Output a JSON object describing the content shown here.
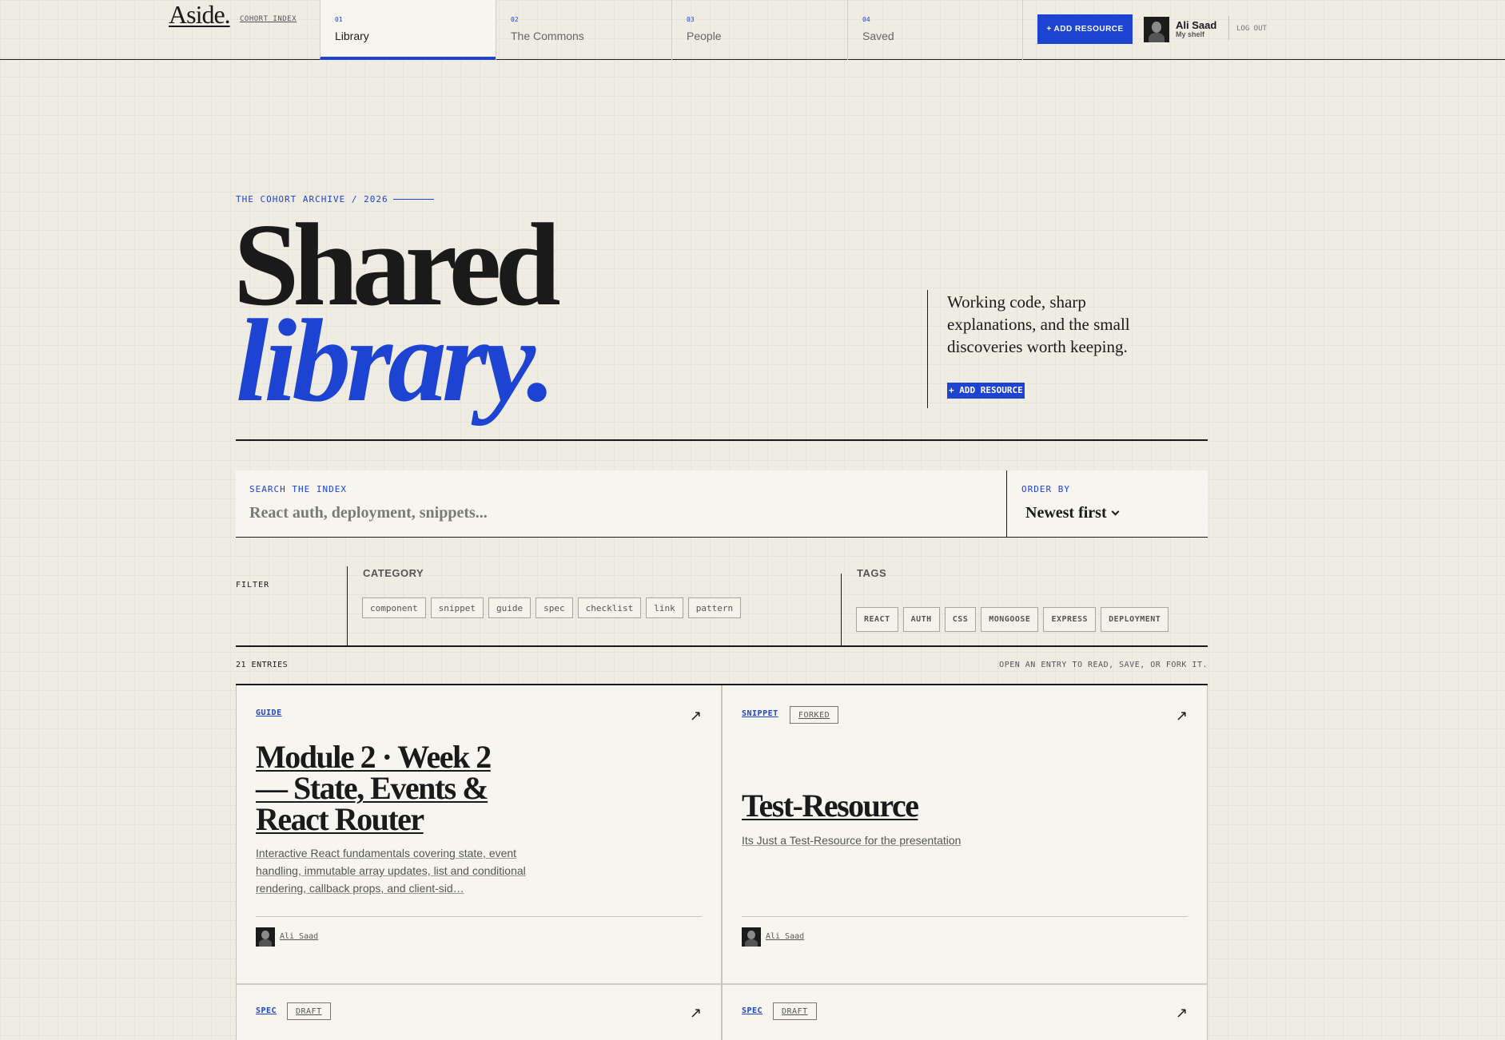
{
  "header": {
    "logo": "Aside.",
    "cohort_link": "COHORT INDEX",
    "tabs": [
      {
        "num": "01",
        "label": "Library"
      },
      {
        "num": "02",
        "label": "The Commons"
      },
      {
        "num": "03",
        "label": "People"
      },
      {
        "num": "04",
        "label": "Saved"
      }
    ],
    "active_tab": "Library",
    "add_button": "+ ADD RESOURCE",
    "user": {
      "name": "Ali Saad",
      "subtitle": "My shelf"
    },
    "logout": "LOG OUT"
  },
  "hero": {
    "eyebrow": "THE COHORT ARCHIVE / 2026",
    "title_line1": "Shared",
    "title_line2": "library.",
    "description": "Working code, sharp explanations, and the small discoveries worth keeping.",
    "add_button": "+ ADD RESOURCE"
  },
  "search": {
    "label": "SEARCH THE INDEX",
    "placeholder": "React auth, deployment, snippets...",
    "value": "",
    "order_label": "ORDER BY",
    "order_value": "Newest first"
  },
  "filters": {
    "label": "FILTER",
    "category_label": "CATEGORY",
    "categories": [
      "component",
      "snippet",
      "guide",
      "spec",
      "checklist",
      "link",
      "pattern"
    ],
    "tags_label": "TAGS",
    "tags": [
      "REACT",
      "AUTH",
      "CSS",
      "MONGOOSE",
      "EXPRESS",
      "DEPLOYMENT"
    ]
  },
  "entries": {
    "count": "21 ENTRIES",
    "hint": "OPEN AN ENTRY TO READ, SAVE, OR FORK IT.",
    "cards": [
      {
        "category": "GUIDE",
        "badge": "",
        "title": "Module 2 · Week 2 — State, Events & React Router",
        "description": "Interactive React fundamentals covering state, event handling, immutable array updates, list and conditional rendering, callback props, and client-sid…",
        "author": "Ali Saad"
      },
      {
        "category": "SNIPPET",
        "badge": "FORKED",
        "title": "Test-Resource",
        "description": "Its Just a Test-Resource for the presentation",
        "author": "Ali Saad"
      },
      {
        "category": "SPEC",
        "badge": "DRAFT"
      },
      {
        "category": "SPEC",
        "badge": "DRAFT"
      }
    ]
  },
  "icons": {
    "arrow": "arrow-up-right-icon",
    "chevron": "chevron-down-icon"
  },
  "colors": {
    "accent": "#1d43d3",
    "background": "#efece4",
    "card": "#f7f5ef",
    "ink": "#1a1a1a"
  }
}
